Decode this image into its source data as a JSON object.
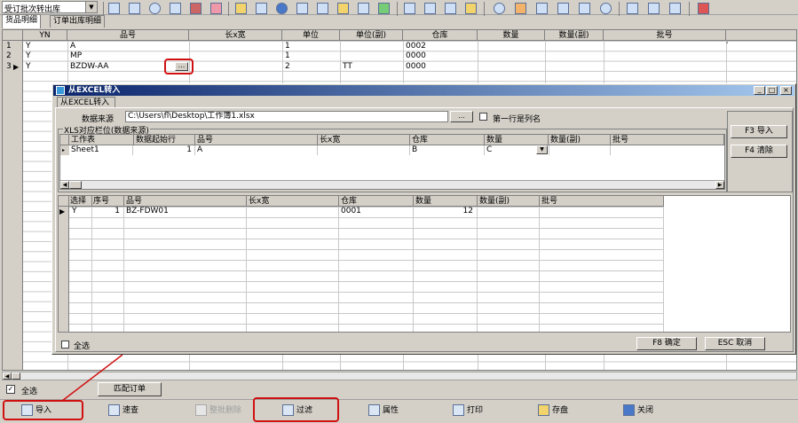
{
  "toolbar": {
    "dropdown_value": "受订批次转出库"
  },
  "tabs": [
    "货品明细",
    "订单出库明细"
  ],
  "main_grid": {
    "columns": [
      "YN",
      "品号",
      "长x宽",
      "单位",
      "单位(副)",
      "仓库",
      "数量",
      "数量(副)",
      "批号"
    ],
    "rows": [
      {
        "num": "1",
        "yn": "Y",
        "item": "A",
        "size": "",
        "unit": "1",
        "unit2": "",
        "wh": "0002"
      },
      {
        "num": "2",
        "yn": "Y",
        "item": "MP",
        "size": "",
        "unit": "1",
        "unit2": "",
        "wh": "0000"
      },
      {
        "num": "3",
        "yn": "Y",
        "item": "BZDW-AA",
        "size": "",
        "unit": "2",
        "unit2": "TT",
        "wh": "0000"
      }
    ],
    "ellipsis": "...",
    "row_marker": "▶"
  },
  "dialog": {
    "title": "从EXCEL转入",
    "tab": "从EXCEL转入",
    "source_label": "数据来源",
    "source_value": "C:\\Users\\fl\\Desktop\\工作簿1.xlsx",
    "browse_label": "...",
    "first_row_label": "第一行是列名",
    "group_label": "XLS对应栏位(数据来源)",
    "map_columns": [
      "工作表",
      "数据起始行",
      "品号",
      "长x宽",
      "仓库",
      "数量",
      "数量(副)",
      "批号"
    ],
    "map_row": {
      "sheet": "Sheet1",
      "start": "1",
      "item": "A",
      "size": "",
      "wh": "B",
      "qty": "C"
    },
    "btn_import": "F3 导入",
    "btn_clear": "F4 清除",
    "result_columns": [
      "选择",
      "序号",
      "品号",
      "长x宽",
      "仓库",
      "数量",
      "数量(副)",
      "批号"
    ],
    "result_row": {
      "sel": "Y",
      "seq": "1",
      "item": "BZ-FDW01",
      "size": "",
      "wh": "0001",
      "qty": "12"
    },
    "select_all": "全选",
    "btn_ok": "F8 确定",
    "btn_cancel": "ESC 取消",
    "win_buttons": [
      "_",
      "□",
      "×"
    ]
  },
  "bottom": {
    "select_all": "全选",
    "match_order": "匹配订单",
    "buttons": [
      "导入",
      "速查",
      "整批删除",
      "过滤",
      "属性",
      "打印",
      "存盘",
      "关闭"
    ]
  },
  "colors": {
    "highlight_red": "#d01010",
    "title_bar": "#0a246a",
    "grid_header_bg": "#d4d0c8"
  }
}
